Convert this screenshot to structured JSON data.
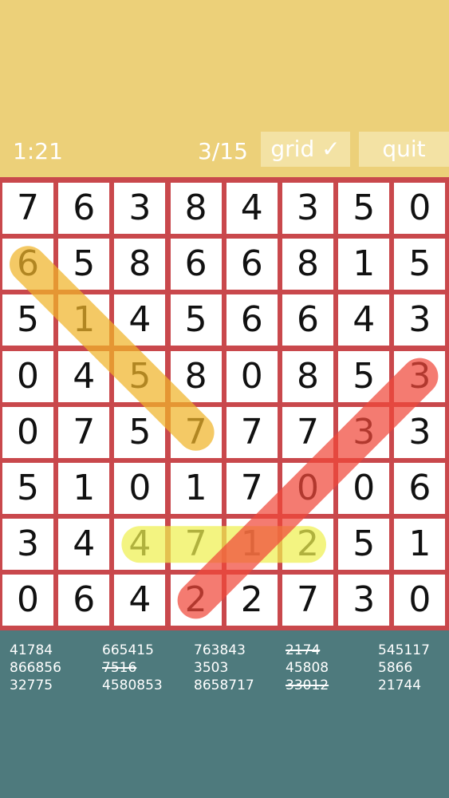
{
  "hud": {
    "timer": "1:21",
    "progress": "3/15",
    "grid_button": "grid ✓",
    "quit_button": "quit"
  },
  "colors": {
    "header_bg": "#ecd079",
    "board_border": "#c9484c",
    "footer_bg": "#4e7a7d",
    "highlight_orange": "#f0b429",
    "highlight_yellow": "#eef050",
    "highlight_red": "#f0483a"
  },
  "grid": [
    [
      "7",
      "6",
      "3",
      "8",
      "4",
      "3",
      "5",
      "0"
    ],
    [
      "6",
      "5",
      "8",
      "6",
      "6",
      "8",
      "1",
      "5"
    ],
    [
      "5",
      "1",
      "4",
      "5",
      "6",
      "6",
      "4",
      "3"
    ],
    [
      "0",
      "4",
      "5",
      "8",
      "0",
      "8",
      "5",
      "3"
    ],
    [
      "0",
      "7",
      "5",
      "7",
      "7",
      "7",
      "3",
      "3"
    ],
    [
      "5",
      "1",
      "0",
      "1",
      "7",
      "0",
      "0",
      "6"
    ],
    [
      "3",
      "4",
      "4",
      "7",
      "1",
      "2",
      "5",
      "1"
    ],
    [
      "0",
      "6",
      "4",
      "2",
      "2",
      "7",
      "3",
      "0"
    ]
  ],
  "highlights": [
    {
      "name": "orange",
      "color": "#f0b429",
      "from": [
        1,
        0
      ],
      "to": [
        4,
        3
      ]
    },
    {
      "name": "yellow",
      "color": "#eef050",
      "from": [
        6,
        2
      ],
      "to": [
        6,
        5
      ]
    },
    {
      "name": "red",
      "color": "#f0483a",
      "from": [
        7,
        3
      ],
      "to": [
        3,
        7
      ]
    }
  ],
  "word_columns": [
    [
      {
        "text": "41784",
        "found": false
      },
      {
        "text": "866856",
        "found": false
      },
      {
        "text": "32775",
        "found": false
      }
    ],
    [
      {
        "text": "665415",
        "found": false
      },
      {
        "text": "7516",
        "found": true
      },
      {
        "text": "4580853",
        "found": false
      }
    ],
    [
      {
        "text": "763843",
        "found": false
      },
      {
        "text": "3503",
        "found": false
      },
      {
        "text": "8658717",
        "found": false
      }
    ],
    [
      {
        "text": "2174",
        "found": true
      },
      {
        "text": "45808",
        "found": false
      },
      {
        "text": "33012",
        "found": true
      }
    ],
    [
      {
        "text": "545117",
        "found": false
      },
      {
        "text": "5866",
        "found": false
      },
      {
        "text": "21744",
        "found": false
      }
    ]
  ]
}
